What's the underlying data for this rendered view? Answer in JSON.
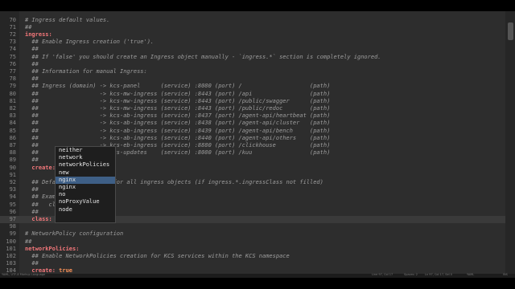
{
  "editor": {
    "lines": [
      {
        "num": "70",
        "segments": [
          {
            "t": "comment",
            "v": "# Ingress default values."
          }
        ]
      },
      {
        "num": "71",
        "segments": [
          {
            "t": "comment",
            "v": "##"
          }
        ]
      },
      {
        "num": "72",
        "segments": [
          {
            "t": "key",
            "v": "ingress:"
          }
        ]
      },
      {
        "num": "73",
        "segments": [
          {
            "t": "comment",
            "v": "  ## Enable Ingress creation ('true')."
          }
        ]
      },
      {
        "num": "74",
        "segments": [
          {
            "t": "comment",
            "v": "  ##"
          }
        ]
      },
      {
        "num": "75",
        "segments": [
          {
            "t": "comment",
            "v": "  ## If 'false' you should create an Ingress object manually - `ingress.*` section is completely ignored."
          }
        ]
      },
      {
        "num": "76",
        "segments": [
          {
            "t": "comment",
            "v": "  ##"
          }
        ]
      },
      {
        "num": "77",
        "segments": [
          {
            "t": "comment",
            "v": "  ## Information for manual Ingress:"
          }
        ]
      },
      {
        "num": "78",
        "segments": [
          {
            "t": "comment",
            "v": "  ##"
          }
        ]
      },
      {
        "num": "79",
        "segments": [
          {
            "t": "comment",
            "v": "  ## Ingress (domain) -> kcs-panel      (service) :8080 (port) /                    (path)"
          }
        ]
      },
      {
        "num": "80",
        "segments": [
          {
            "t": "comment",
            "v": "  ##                  -> kcs-mw-ingress (service) :8443 (port) /api                 (path)"
          }
        ]
      },
      {
        "num": "81",
        "segments": [
          {
            "t": "comment",
            "v": "  ##                  -> kcs-mw-ingress (service) :8443 (port) /public/swagger      (path)"
          }
        ]
      },
      {
        "num": "82",
        "segments": [
          {
            "t": "comment",
            "v": "  ##                  -> kcs-mw-ingress (service) :8443 (port) /public/redoc        (path)"
          }
        ]
      },
      {
        "num": "83",
        "segments": [
          {
            "t": "comment",
            "v": "  ##                  -> kcs-ab-ingress (service) :8437 (port) /agent-api/heartbeat (path)"
          }
        ]
      },
      {
        "num": "84",
        "segments": [
          {
            "t": "comment",
            "v": "  ##                  -> kcs-ab-ingress (service) :8438 (port) /agent-api/cluster   (path)"
          }
        ]
      },
      {
        "num": "85",
        "segments": [
          {
            "t": "comment",
            "v": "  ##                  -> kcs-ab-ingress (service) :8439 (port) /agent-api/bench     (path)"
          }
        ]
      },
      {
        "num": "86",
        "segments": [
          {
            "t": "comment",
            "v": "  ##                  -> kcs-ab-ingress (service) :8440 (port) /agent-api/others    (path)"
          }
        ]
      },
      {
        "num": "87",
        "segments": [
          {
            "t": "comment",
            "v": "  ##                  -> kcs-eb-ingress (service) :8880 (port) /clickhouse          (path)"
          }
        ]
      },
      {
        "num": "88",
        "segments": [
          {
            "t": "comment",
            "v": "  ##                  -> kcs-updates    (service) :8080 (port) /kuu                 (path)"
          }
        ]
      },
      {
        "num": "89",
        "segments": [
          {
            "t": "comment",
            "v": "  ##"
          }
        ]
      },
      {
        "num": "90",
        "segments": [
          {
            "t": "key",
            "v": "  create:"
          },
          {
            "t": "bool",
            "v": " true"
          }
        ]
      },
      {
        "num": "91",
        "segments": [
          {
            "t": "comment",
            "v": ""
          }
        ]
      },
      {
        "num": "92",
        "segments": [
          {
            "t": "comment",
            "v": "  ## Default IngressClass for all ingress objects (if ingress.*.ingressClass not filled)"
          }
        ]
      },
      {
        "num": "93",
        "segments": [
          {
            "t": "comment",
            "v": "  ##"
          }
        ]
      },
      {
        "num": "94",
        "segments": [
          {
            "t": "comment",
            "v": "  ## Example:"
          }
        ]
      },
      {
        "num": "95",
        "segments": [
          {
            "t": "comment",
            "v": "  ##   class: nginx"
          }
        ]
      },
      {
        "num": "96",
        "segments": [
          {
            "t": "comment",
            "v": "  ##"
          }
        ]
      },
      {
        "num": "97",
        "segments": [
          {
            "t": "key",
            "v": "  class:"
          },
          {
            "t": "str",
            "v": " \"nginx\""
          }
        ],
        "current": true
      },
      {
        "num": "98",
        "segments": [
          {
            "t": "comment",
            "v": ""
          }
        ]
      },
      {
        "num": "99",
        "segments": [
          {
            "t": "comment",
            "v": "# NetworkPolicy configuration"
          }
        ]
      },
      {
        "num": "100",
        "segments": [
          {
            "t": "comment",
            "v": "##"
          }
        ]
      },
      {
        "num": "101",
        "segments": [
          {
            "t": "key",
            "v": "networkPolicies:"
          }
        ]
      },
      {
        "num": "102",
        "segments": [
          {
            "t": "comment",
            "v": "  ## Enable NetworkPolicies creation for KCS services within the KCS namespace"
          }
        ]
      },
      {
        "num": "103",
        "segments": [
          {
            "t": "comment",
            "v": "  ##"
          }
        ]
      },
      {
        "num": "104",
        "segments": [
          {
            "t": "key",
            "v": "  create:"
          },
          {
            "t": "bool",
            "v": " true"
          }
        ]
      }
    ]
  },
  "autocomplete": {
    "items": [
      "neither",
      "network",
      "networkPolicies",
      "new",
      "nginx",
      "nginx",
      "no",
      "noProxyValue",
      "node"
    ],
    "selected_index": 4
  },
  "statusbar": {
    "left": "YAML, UTF-8 Markup Language",
    "mid1": "Line 97, Col 17",
    "mid2": "Spaces: 2",
    "mid3": "Ln 97, Col 17, Sel 0",
    "mid4": "YAML",
    "right": "INS"
  },
  "colors": {
    "editor_bg": "#2d2d2d",
    "comment": "#9d9d9d",
    "key": "#f2777a",
    "bool": "#f99157",
    "selection": "#3e5f86"
  }
}
